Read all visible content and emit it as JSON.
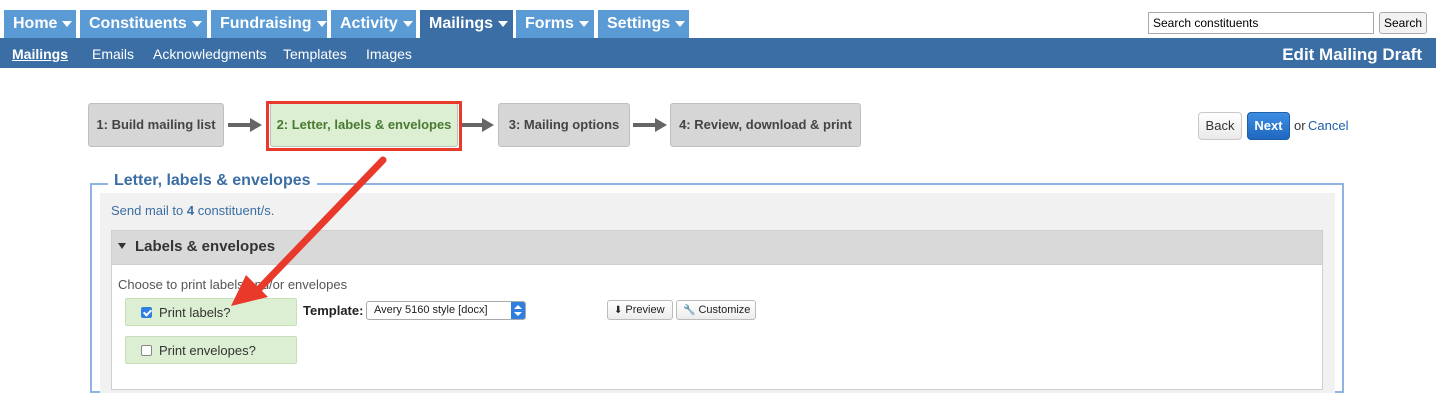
{
  "topnav": {
    "tabs": [
      {
        "label": "Home",
        "active": false
      },
      {
        "label": "Constituents",
        "active": false
      },
      {
        "label": "Fundraising",
        "active": false
      },
      {
        "label": "Activity",
        "active": false
      },
      {
        "label": "Mailings",
        "active": true
      },
      {
        "label": "Forms",
        "active": false
      },
      {
        "label": "Settings",
        "active": false
      }
    ],
    "search_placeholder": "Search constituents",
    "search_value": "Search constituents",
    "search_button": "Search"
  },
  "subnav": {
    "items": [
      {
        "label": "Mailings",
        "active": true
      },
      {
        "label": "Emails",
        "active": false
      },
      {
        "label": "Acknowledgments",
        "active": false
      },
      {
        "label": "Templates",
        "active": false
      },
      {
        "label": "Images",
        "active": false
      }
    ],
    "page_title": "Edit Mailing Draft"
  },
  "wizard": {
    "steps": [
      {
        "label": "1: Build mailing list",
        "current": false
      },
      {
        "label": "2: Letter, labels & envelopes",
        "current": true
      },
      {
        "label": "3: Mailing options",
        "current": false
      },
      {
        "label": "4: Review, download & print",
        "current": false
      }
    ],
    "back_label": "Back",
    "next_label": "Next",
    "or_text": "or",
    "cancel_label": "Cancel"
  },
  "panel": {
    "legend": "Letter, labels & envelopes",
    "send_prefix": "Send mail to ",
    "send_count": "4",
    "send_suffix": " constituent/s.",
    "section_title": "Labels & envelopes",
    "choose_text": "Choose to print labels and/or envelopes",
    "print_labels": {
      "label": "Print labels?",
      "checked": true
    },
    "print_envelopes": {
      "label": "Print envelopes?",
      "checked": false
    },
    "template_label": "Template:",
    "template_value": "Avery 5160 style [docx]",
    "preview_label": "Preview",
    "customize_label": "Customize"
  },
  "colors": {
    "nav_tab": "#5b9bd5",
    "nav_active": "#3a6ea5",
    "subnav_bg": "#3b6ea4",
    "step_current_bg": "#dcefd3",
    "highlight_red": "#e8392a",
    "next_blue": "#1f67c0"
  }
}
